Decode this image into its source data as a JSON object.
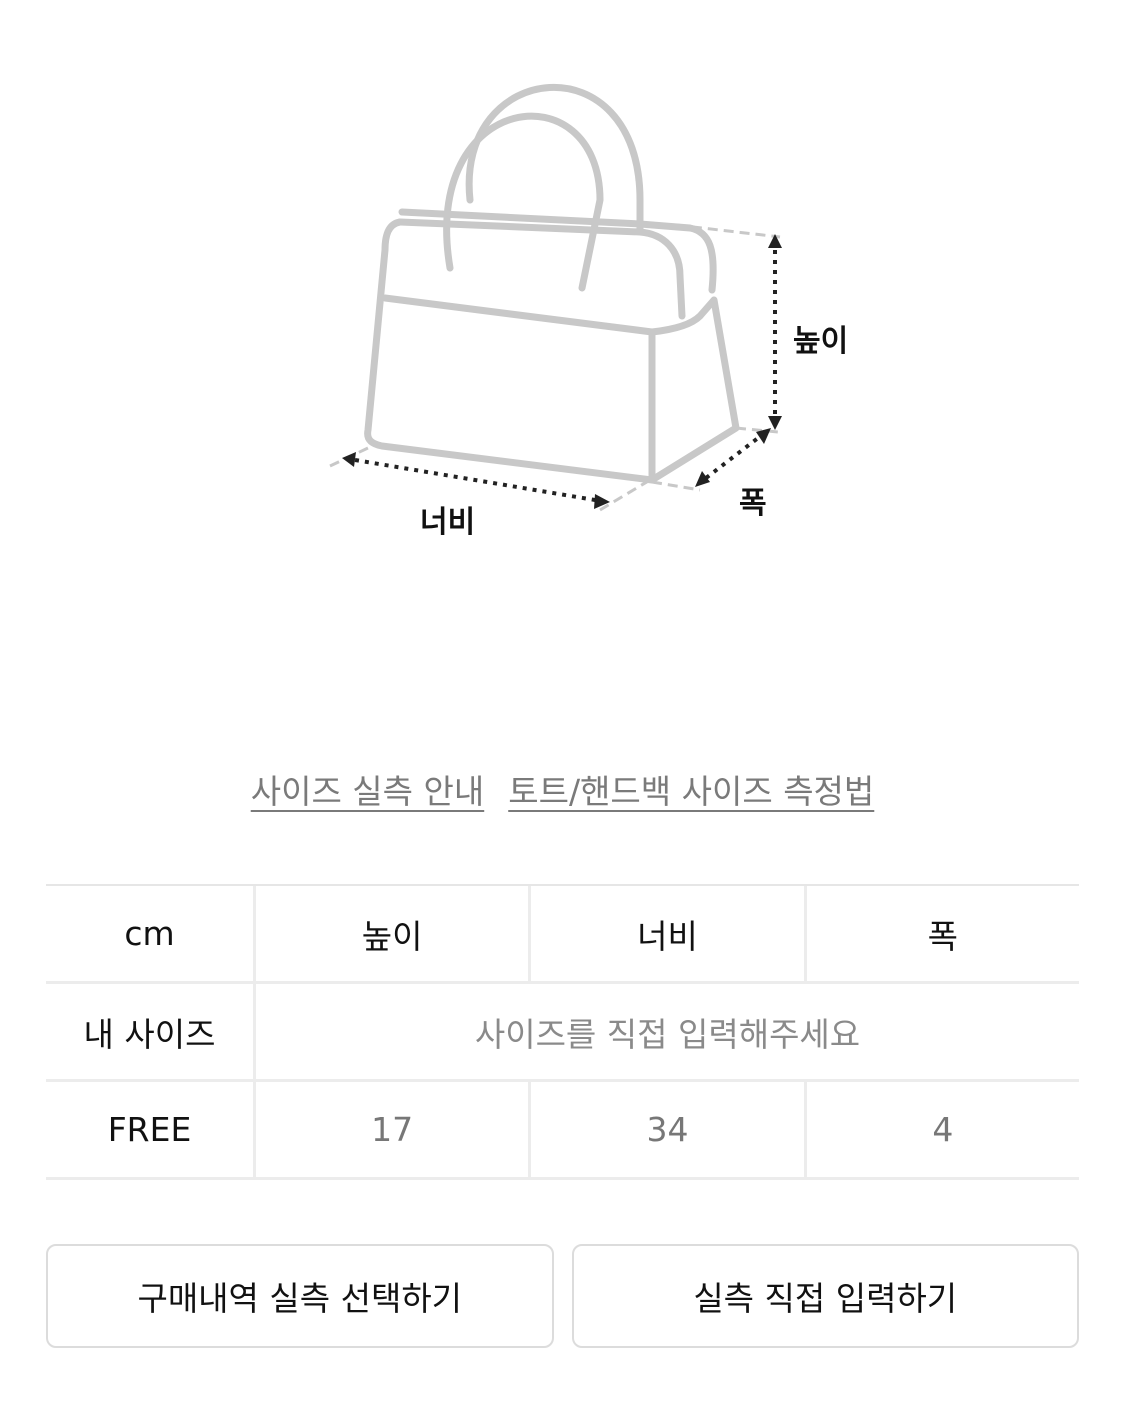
{
  "diagram": {
    "labels": {
      "height": "높이",
      "width": "너비",
      "depth": "폭"
    }
  },
  "links": {
    "size_guide": "사이즈 실측 안내",
    "measure_method": "토트/핸드백 사이즈 측정법"
  },
  "table": {
    "headers": [
      "cm",
      "높이",
      "너비",
      "폭"
    ],
    "my_size": {
      "label": "내 사이즈",
      "placeholder": "사이즈를 직접 입력해주세요"
    },
    "rows": [
      {
        "label": "FREE",
        "values": [
          "17",
          "34",
          "4"
        ]
      }
    ]
  },
  "buttons": {
    "select_purchase": "구매내역 실측 선택하기",
    "manual_input": "실측 직접 입력하기"
  }
}
